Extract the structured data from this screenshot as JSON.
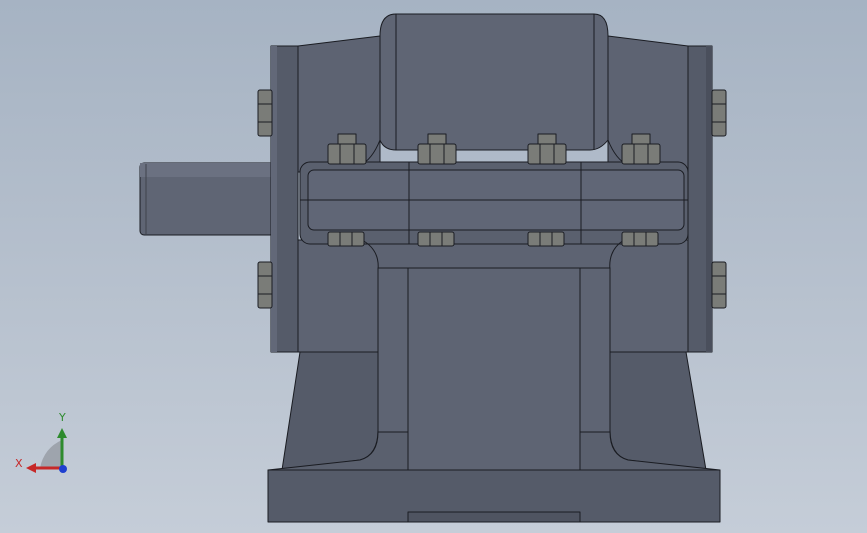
{
  "triad": {
    "x_label": "X",
    "y_label": "Y"
  },
  "colors": {
    "viewport_top": "#a6b3c3",
    "viewport_bottom": "#c5cdd8",
    "body": "#5d6372",
    "body_dark": "#474c58",
    "body_light": "#6a7080",
    "edge": "#1a1c22",
    "fastener": "#7a7c78",
    "axis_x": "#c62828",
    "axis_y": "#2e8b2e",
    "axis_z": "#1e3fd0"
  }
}
